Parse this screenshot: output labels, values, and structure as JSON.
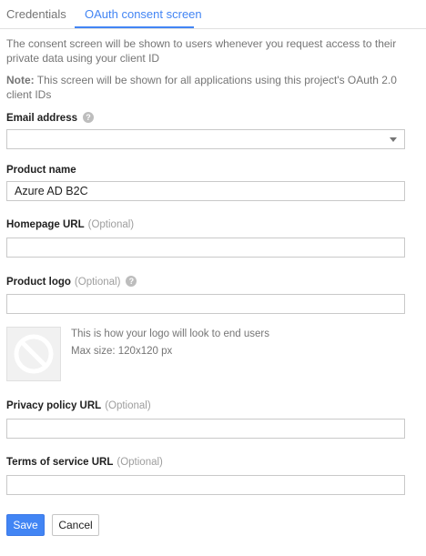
{
  "tabs": [
    {
      "label": "Credentials",
      "active": false
    },
    {
      "label": "OAuth consent screen",
      "active": true
    }
  ],
  "description": "The consent screen will be shown to users whenever you request access to their private data using your client ID",
  "note": {
    "prefix": "Note:",
    "text": " This screen will be shown for all applications using this project's OAuth 2.0 client IDs"
  },
  "form": {
    "email": {
      "label": "Email address",
      "value": ""
    },
    "product_name": {
      "label": "Product name",
      "value": "Azure AD B2C"
    },
    "homepage_url": {
      "label": "Homepage URL",
      "optional": "(Optional)",
      "value": ""
    },
    "product_logo": {
      "label": "Product logo",
      "optional": "(Optional)",
      "value": ""
    },
    "logo_preview": {
      "line1": "This is how your logo will look to end users",
      "line2": "Max size: 120x120 px"
    },
    "privacy_url": {
      "label": "Privacy policy URL",
      "optional": "(Optional)",
      "value": ""
    },
    "tos_url": {
      "label": "Terms of service URL",
      "optional": "(Optional)",
      "value": ""
    }
  },
  "buttons": {
    "save": "Save",
    "cancel": "Cancel"
  },
  "colors": {
    "accent": "#4285f4"
  }
}
